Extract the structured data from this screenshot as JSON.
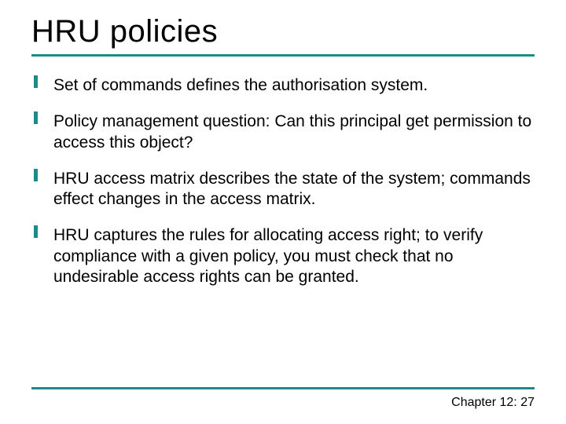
{
  "title": "HRU policies",
  "bullets": [
    "Set of commands defines the authorisation system.",
    "Policy management question: Can this principal get permission to access this object?",
    "HRU access matrix describes the state of the system; commands effect changes in the access matrix.",
    "HRU captures the rules for allocating access right; to verify compliance with a given policy, you must check that no undesirable access rights can be granted."
  ],
  "footer": "Chapter 12: 27"
}
